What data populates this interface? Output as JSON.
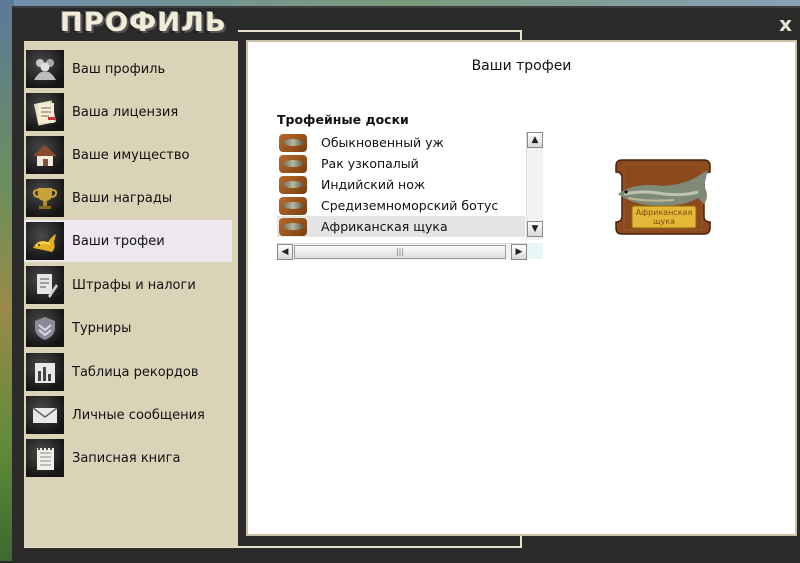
{
  "window": {
    "title": "ПРОФИЛЬ",
    "close": "x"
  },
  "sidebar": {
    "items": [
      {
        "label": "Ваш профиль",
        "icon": "users-icon"
      },
      {
        "label": "Ваша лицензия",
        "icon": "license-icon"
      },
      {
        "label": "Ваше имущество",
        "icon": "house-icon"
      },
      {
        "label": "Ваши награды",
        "icon": "trophy-cup-icon"
      },
      {
        "label": "Ваши трофеи",
        "icon": "fish-trophy-icon",
        "active": true
      },
      {
        "label": "Штрафы и налоги",
        "icon": "fines-document-icon"
      },
      {
        "label": "Турниры",
        "icon": "tournament-shield-icon"
      },
      {
        "label": "Таблица рекордов",
        "icon": "bar-chart-icon"
      },
      {
        "label": "Личные сообщения",
        "icon": "envelope-icon"
      },
      {
        "label": "Записная книга",
        "icon": "notebook-icon"
      }
    ]
  },
  "content": {
    "title": "Ваши трофеи",
    "section_label": "Трофейные доски",
    "trophies": [
      {
        "name": "Обыкновенный уж"
      },
      {
        "name": "Рак узкопалый"
      },
      {
        "name": "Индийский нож"
      },
      {
        "name": "Средиземноморский ботус"
      },
      {
        "name": "Африканская щука",
        "selected": true
      }
    ],
    "preview": {
      "caption_line1": "Африканская",
      "caption_line2": "щука"
    }
  },
  "colors": {
    "sidebar_bg": "#dbd3b8",
    "window_bg": "#2b2b2b",
    "active_item_bg": "#ece8ee",
    "plaque_wood": "#8a4a1e"
  }
}
